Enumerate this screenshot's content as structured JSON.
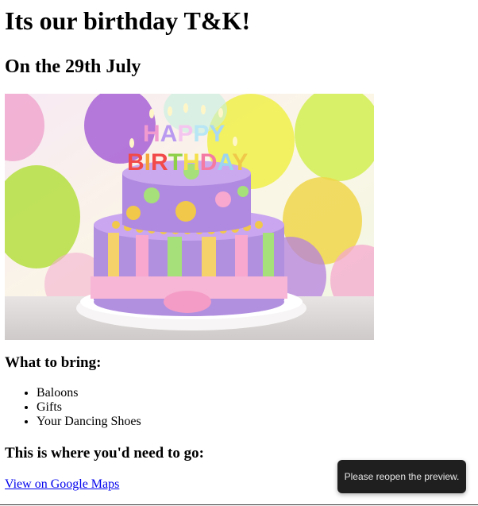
{
  "page": {
    "title": "Its our birthday T&K!",
    "date": "On the 29th July",
    "image": {
      "cake_topper": [
        "HAPPY",
        "BIRTHDAY"
      ]
    },
    "bring_heading": "What to bring:",
    "bring_items": [
      "Baloons",
      "Gifts",
      "Your Dancing Shoes"
    ],
    "go_heading": "This is where you'd need to go:",
    "map_link": "View on Google Maps"
  },
  "toast": {
    "message": "Please reopen the preview."
  },
  "colors": {
    "link": "#0000ee",
    "toast_bg": "#1f1f1f",
    "toast_text": "#e6e6e6"
  }
}
